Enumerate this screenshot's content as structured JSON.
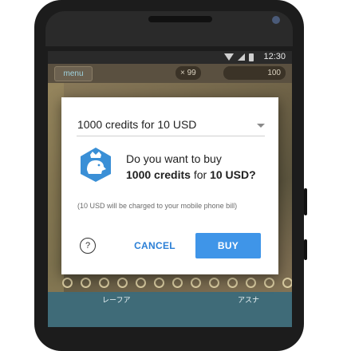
{
  "status_bar": {
    "time": "12:30"
  },
  "game_bar": {
    "menu_label": "menu",
    "item_count": "× 99",
    "credits": "100"
  },
  "background": {
    "char_label_1": "レーフア",
    "char_label_2": "アスナ"
  },
  "dialog": {
    "product_select": "1000 credits for 10 USD",
    "question_line1": "Do you want to buy",
    "question_line2_amount": "1000 credits",
    "question_line2_for": " for ",
    "question_line2_price": "10 USD?",
    "charge_note": "(10 USD will be charged to your mobile phone bill)",
    "help_label": "?",
    "cancel_label": "CANCEL",
    "buy_label": "BUY"
  },
  "colors": {
    "accent": "#3f95e8",
    "cancel_text": "#2b7fd6",
    "icon_blue": "#3a8fd6"
  }
}
